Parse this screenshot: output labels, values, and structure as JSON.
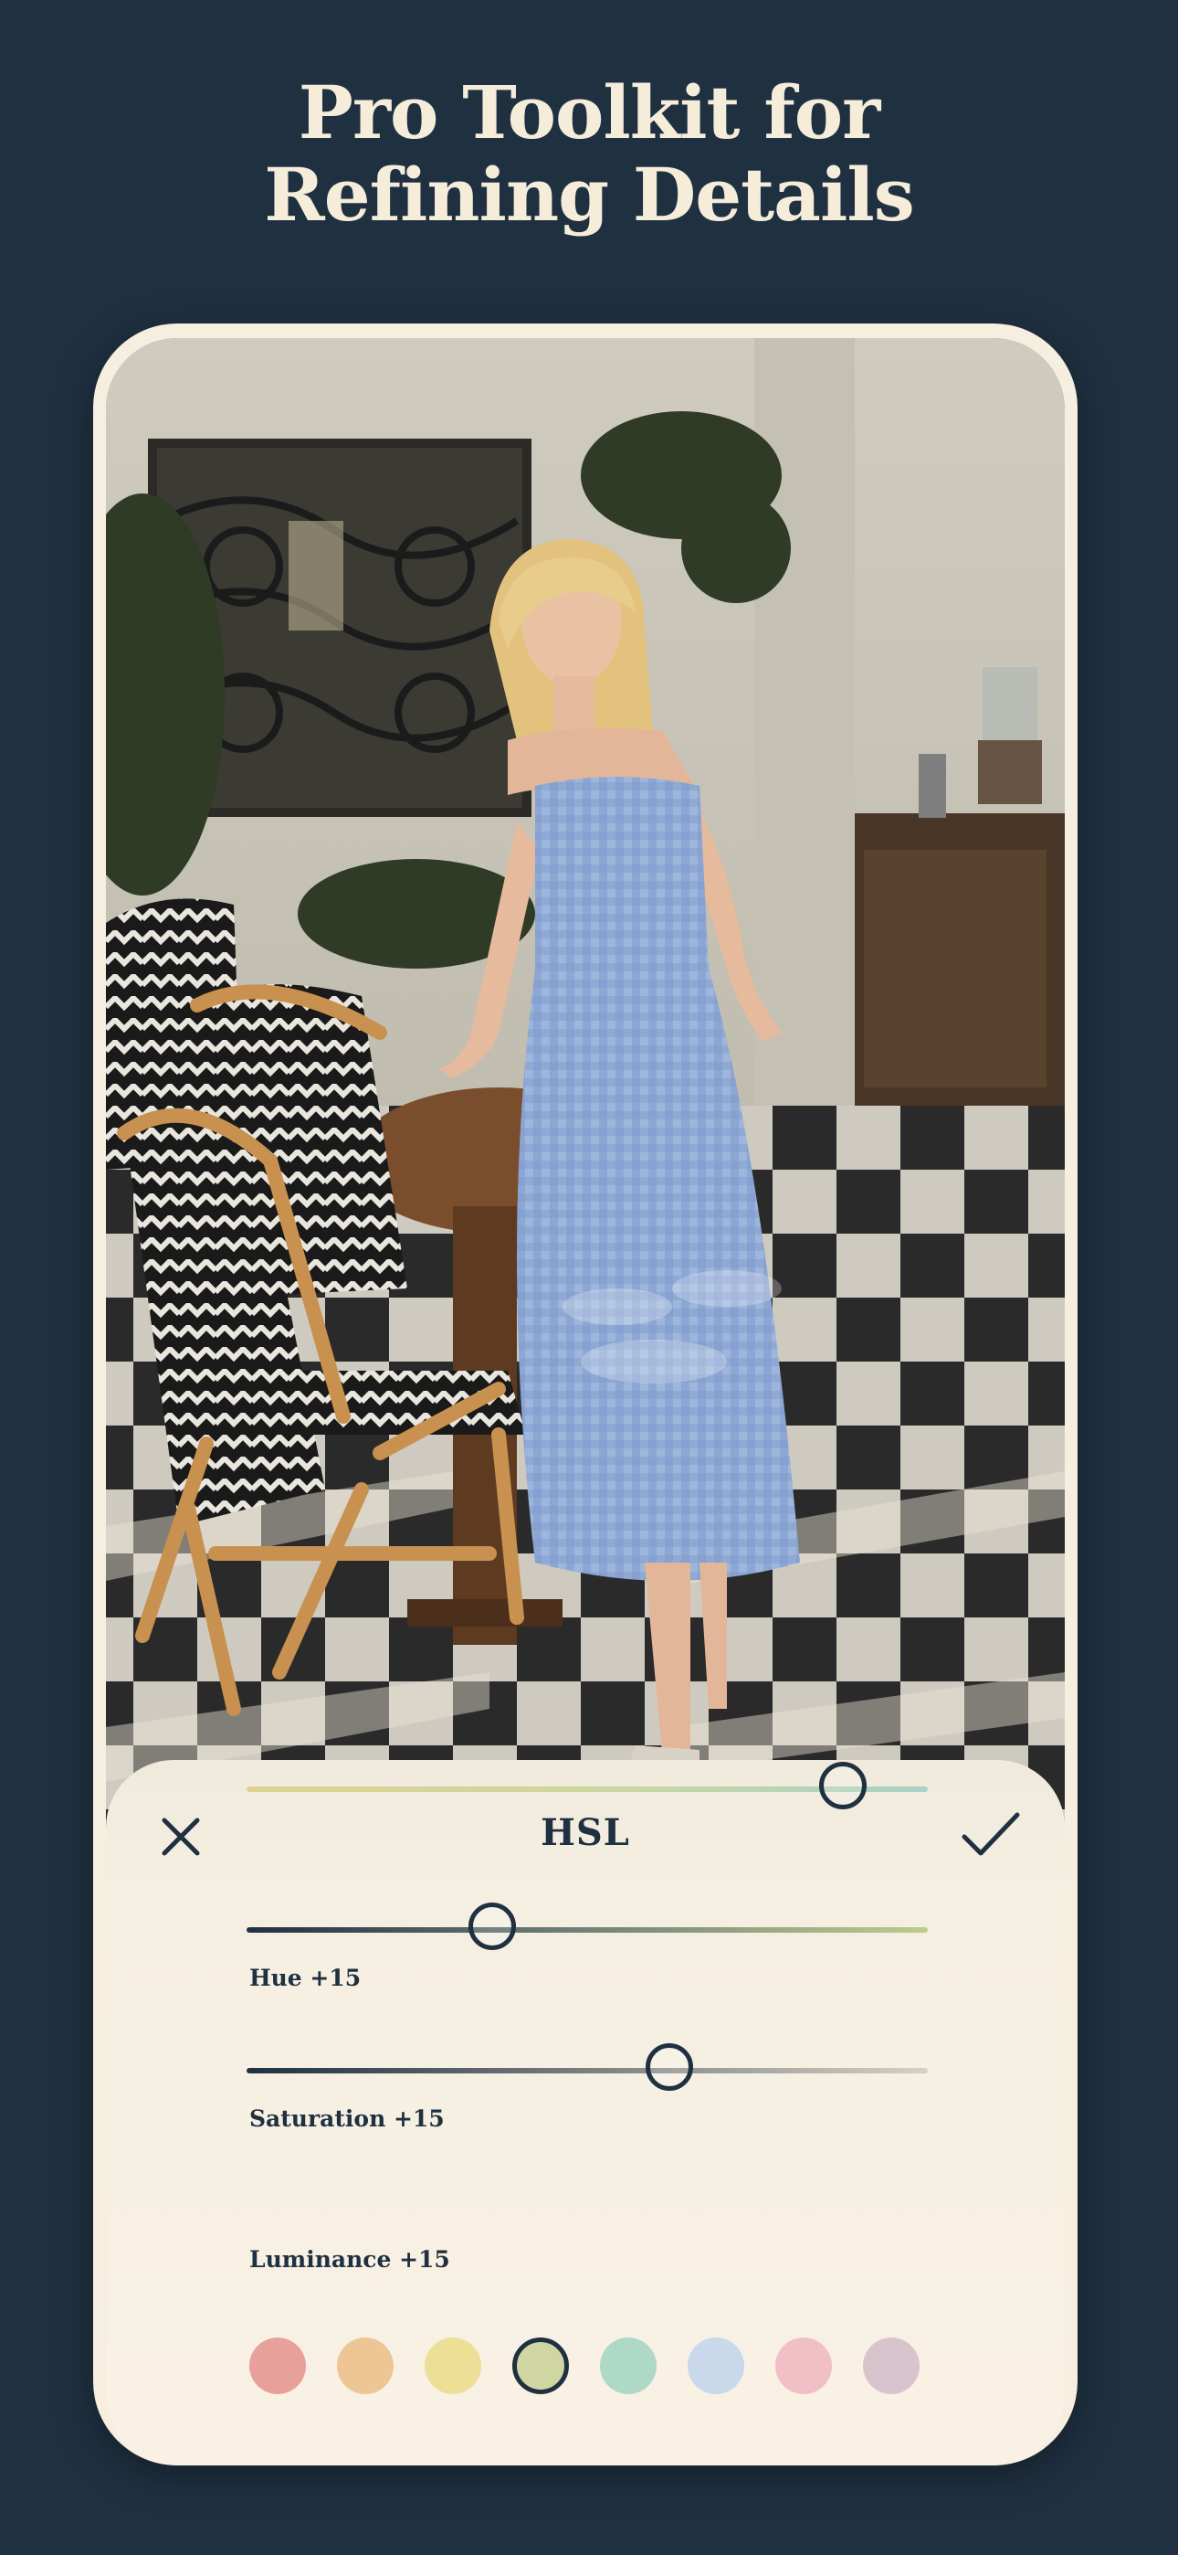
{
  "headline": {
    "line1": "Pro Toolkit for",
    "line2": "Refining Details"
  },
  "panel": {
    "title": "HSL",
    "close_icon": "close-icon",
    "confirm_icon": "checkmark-icon"
  },
  "sliders": [
    {
      "key": "hue",
      "label": "Hue +15",
      "value_fraction": 0.875
    },
    {
      "key": "saturation",
      "label": "Saturation +15",
      "value_fraction": 0.36
    },
    {
      "key": "luminance",
      "label": "Luminance +15",
      "value_fraction": 0.62
    }
  ],
  "color_swatches": [
    {
      "name": "red",
      "color": "#e8a09a",
      "selected": false
    },
    {
      "name": "orange",
      "color": "#eec595",
      "selected": false
    },
    {
      "name": "yellow",
      "color": "#ede096",
      "selected": false
    },
    {
      "name": "green",
      "color": "#cfd6a2",
      "selected": true
    },
    {
      "name": "aqua",
      "color": "#add9c6",
      "selected": false
    },
    {
      "name": "blue",
      "color": "#c9d8ea",
      "selected": false
    },
    {
      "name": "pink",
      "color": "#f1bfc6",
      "selected": false
    },
    {
      "name": "purple",
      "color": "#d9c4cd",
      "selected": false
    }
  ],
  "colors": {
    "background": "#1f3041",
    "headline_text": "#f5ecda",
    "device_frame": "#f6eedf",
    "panel_text": "#1f3041"
  }
}
